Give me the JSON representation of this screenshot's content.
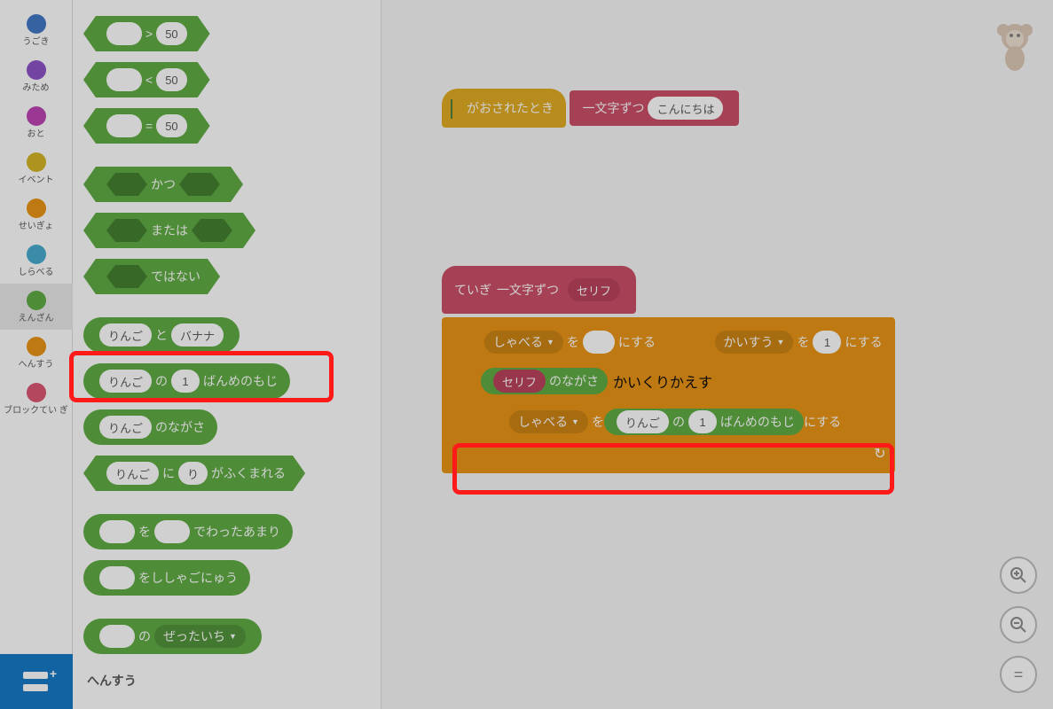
{
  "categories": [
    {
      "label": "うごき",
      "color": "#3b73c4"
    },
    {
      "label": "みため",
      "color": "#8a4cc6"
    },
    {
      "label": "おと",
      "color": "#b93bb1"
    },
    {
      "label": "イベント",
      "color": "#d1b21b"
    },
    {
      "label": "せいぎょ",
      "color": "#e8900c"
    },
    {
      "label": "しらべる",
      "color": "#3fa8cd"
    },
    {
      "label": "えんざん",
      "color": "#59a83d"
    },
    {
      "label": "へんすう",
      "color": "#e8900c"
    },
    {
      "label": "ブロックてい\nぎ",
      "color": "#d9506e"
    }
  ],
  "active_category_index": 6,
  "palette_blocks": {
    "gt": {
      "op": ">",
      "val": "50"
    },
    "lt": {
      "op": "<",
      "val": "50"
    },
    "eq": {
      "op": "=",
      "val": "50"
    },
    "and": "かつ",
    "or": "または",
    "not": "ではない",
    "join": {
      "a": "りんご",
      "mid": "と",
      "b": "バナナ"
    },
    "letter_of": {
      "a": "りんご",
      "mid1": "の",
      "n": "1",
      "mid2": "ばんめのもじ"
    },
    "length_of": {
      "a": "りんご",
      "suffix": "のながさ"
    },
    "contains": {
      "a": "りんご",
      "mid": "に",
      "b": "り",
      "suffix": "がふくまれる"
    },
    "mod": {
      "mid": "を",
      "suffix": "でわったあまり"
    },
    "round": {
      "suffix": "をししゃごにゅう"
    },
    "mathop": {
      "mid": "の",
      "func": "ぜったいち"
    }
  },
  "section_var_header": "へんすう",
  "workspace": {
    "hat_label": "がおされたとき",
    "say_block": {
      "prefix": "一文字ずつ",
      "val": "こんにちは"
    },
    "define": {
      "prefix": "ていぎ",
      "name": "一文字ずつ",
      "arg": "セリフ"
    },
    "set_var1": {
      "var": "しゃべる",
      "mid": "を",
      "val": "",
      "suffix": "にする"
    },
    "set_var2": {
      "var": "かいすう",
      "mid": "を",
      "val": "1",
      "suffix": "にする"
    },
    "repeat": {
      "arg_var": "セリフ",
      "arg_suffix": "のながさ",
      "suffix": "かいくりかえす"
    },
    "set_inside": {
      "var": "しゃべる",
      "mid": "を",
      "letter_a": "りんご",
      "letter_mid1": "の",
      "letter_n": "1",
      "letter_mid2": "ばんめのもじ",
      "suffix": "にする"
    }
  },
  "zoom": {
    "in": "+",
    "out": "−",
    "reset": "="
  }
}
